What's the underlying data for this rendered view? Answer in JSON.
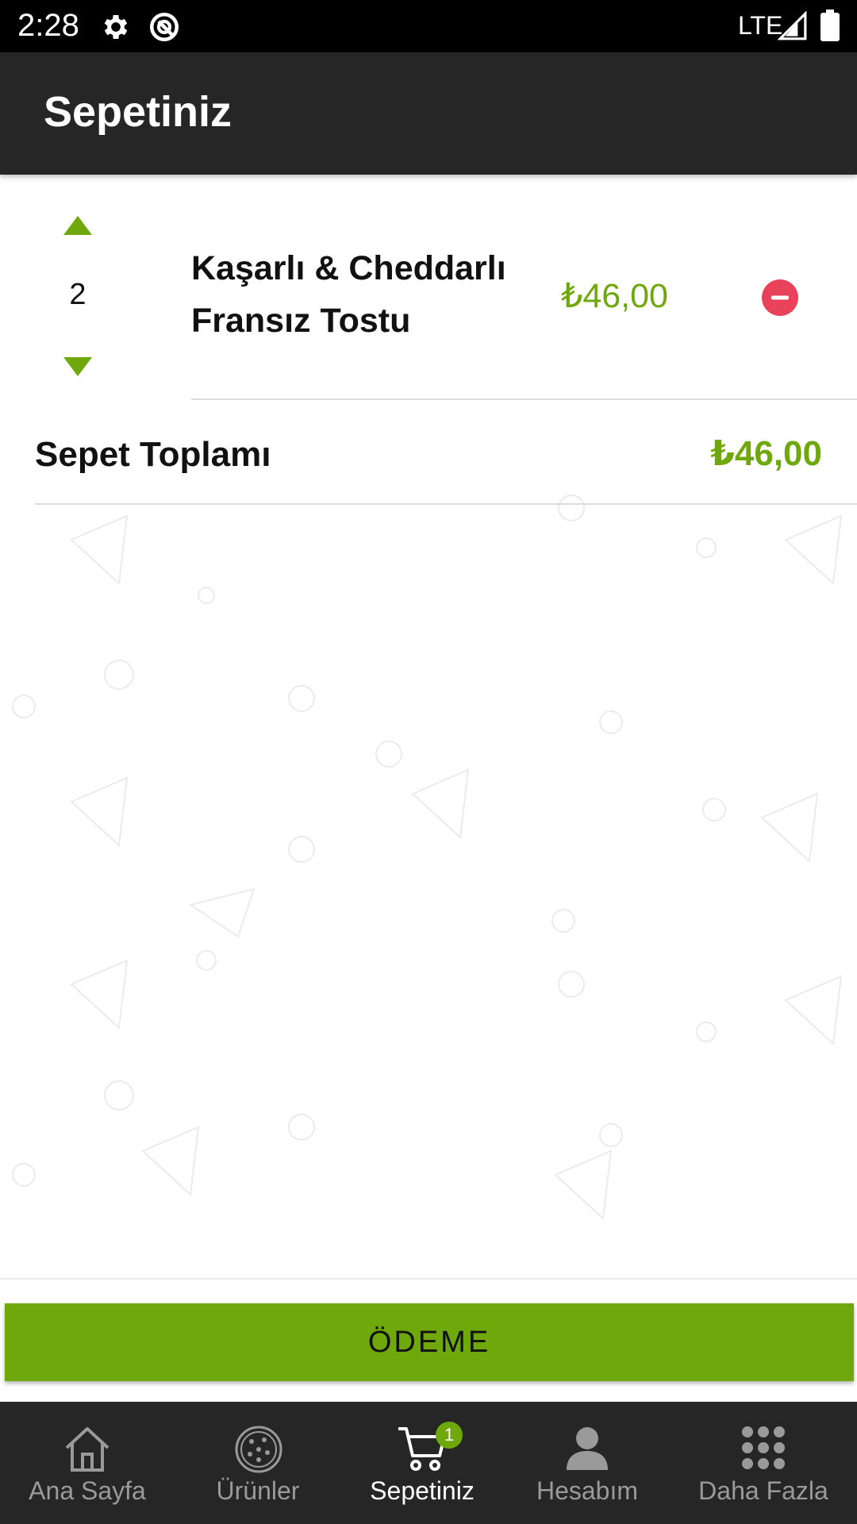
{
  "status_bar": {
    "time": "2:28",
    "network": "LTE"
  },
  "app_bar": {
    "title": "Sepetiniz"
  },
  "cart": {
    "items": [
      {
        "quantity": "2",
        "name_line1": "Kaşarlı & Cheddarlı",
        "name_line2": "Fransız Tostu",
        "price": "₺46,00"
      }
    ],
    "total_label": "Sepet Toplamı",
    "total_value": "₺46,00"
  },
  "checkout": {
    "label": "ÖDEME"
  },
  "bottom_nav": {
    "items": [
      {
        "label": "Ana Sayfa",
        "icon": "home-icon"
      },
      {
        "label": "Ürünler",
        "icon": "pizza-icon"
      },
      {
        "label": "Sepetiniz",
        "icon": "cart-icon",
        "badge": "1",
        "active": true
      },
      {
        "label": "Hesabım",
        "icon": "person-icon"
      },
      {
        "label": "Daha Fazla",
        "icon": "grid-icon"
      }
    ]
  },
  "colors": {
    "accent": "#6ea80a",
    "remove": "#e8435a",
    "bar": "#262626"
  }
}
